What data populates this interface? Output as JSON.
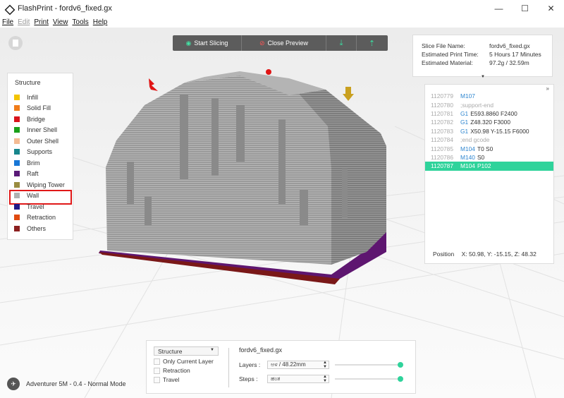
{
  "window": {
    "title": "FlashPrint - fordv6_fixed.gx",
    "minimize": "—",
    "maximize": "☐",
    "close": "✕"
  },
  "menu": [
    {
      "label": "File",
      "disabled": false
    },
    {
      "label": "Edit",
      "disabled": true
    },
    {
      "label": "Print",
      "disabled": false
    },
    {
      "label": "View",
      "disabled": false
    },
    {
      "label": "Tools",
      "disabled": false
    },
    {
      "label": "Help",
      "disabled": false
    }
  ],
  "toolbar": {
    "start_slicing": "Start Slicing",
    "close_preview": "Close Preview",
    "download_icon": "download-icon",
    "send_icon": "send-to-printer-icon"
  },
  "info": {
    "rows": [
      {
        "key": "Slice File Name:",
        "value": "fordv6_fixed.gx"
      },
      {
        "key": "Estimated Print Time:",
        "value": "5 Hours 17 Minutes"
      },
      {
        "key": "Estimated Material:",
        "value": "97.2g / 32.59m"
      }
    ]
  },
  "legend": {
    "title": "Structure",
    "items": [
      {
        "label": "Infill",
        "color": "#f3c400"
      },
      {
        "label": "Solid Fill",
        "color": "#f07d1a"
      },
      {
        "label": "Bridge",
        "color": "#d9141c"
      },
      {
        "label": "Inner Shell",
        "color": "#1aa01a"
      },
      {
        "label": "Outer Shell",
        "color": "#f4bb93"
      },
      {
        "label": "Supports",
        "color": "#17868c"
      },
      {
        "label": "Brim",
        "color": "#1877d6"
      },
      {
        "label": "Raft",
        "color": "#5a1a78"
      },
      {
        "label": "Wiping Tower",
        "color": "#9a8c40"
      },
      {
        "label": "Wall",
        "color": "#b0b0b0"
      },
      {
        "label": "Travel",
        "color": "#1f1a88"
      },
      {
        "label": "Retraction",
        "color": "#e04a10"
      },
      {
        "label": "Others",
        "color": "#8c2020"
      }
    ]
  },
  "gcode": {
    "expand": "»",
    "lines": [
      {
        "num": "1120779",
        "cmd": "M107",
        "args": "",
        "comment": ""
      },
      {
        "num": "1120780",
        "cmd": "",
        "args": "",
        "comment": ";support-end"
      },
      {
        "num": "1120781",
        "cmd": "G1",
        "args": "E593.8860 F2400",
        "comment": ""
      },
      {
        "num": "1120782",
        "cmd": "G1",
        "args": "Z48.320 F3000",
        "comment": ""
      },
      {
        "num": "1120783",
        "cmd": "G1",
        "args": "X50.98 Y-15.15 F6000",
        "comment": ""
      },
      {
        "num": "1120784",
        "cmd": "",
        "args": "",
        "comment": ";end gcode"
      },
      {
        "num": "1120785",
        "cmd": "M104",
        "args": "T0 S0",
        "comment": ""
      },
      {
        "num": "1120786",
        "cmd": "M140",
        "args": "S0",
        "comment": ""
      },
      {
        "num": "1120787",
        "cmd": "M104",
        "args": "P102",
        "comment": ""
      }
    ],
    "position_label": "Position",
    "position_value": "X: 50.98, Y: -15.15, Z: 48.32"
  },
  "controls": {
    "mode": "Structure",
    "checkboxes": [
      "Only Current Layer",
      "Retraction",
      "Travel"
    ],
    "file_name": "fordv6_fixed.gx",
    "layers_label": "Layers :",
    "layers_value": "ಅಳ / 48.22mm",
    "steps_label": "Steps :",
    "steps_value": "ಹಂತ",
    "layers_slider": 1.0,
    "steps_slider": 1.0
  },
  "machine": "Adventurer 5M - 0.4 - Normal Mode"
}
